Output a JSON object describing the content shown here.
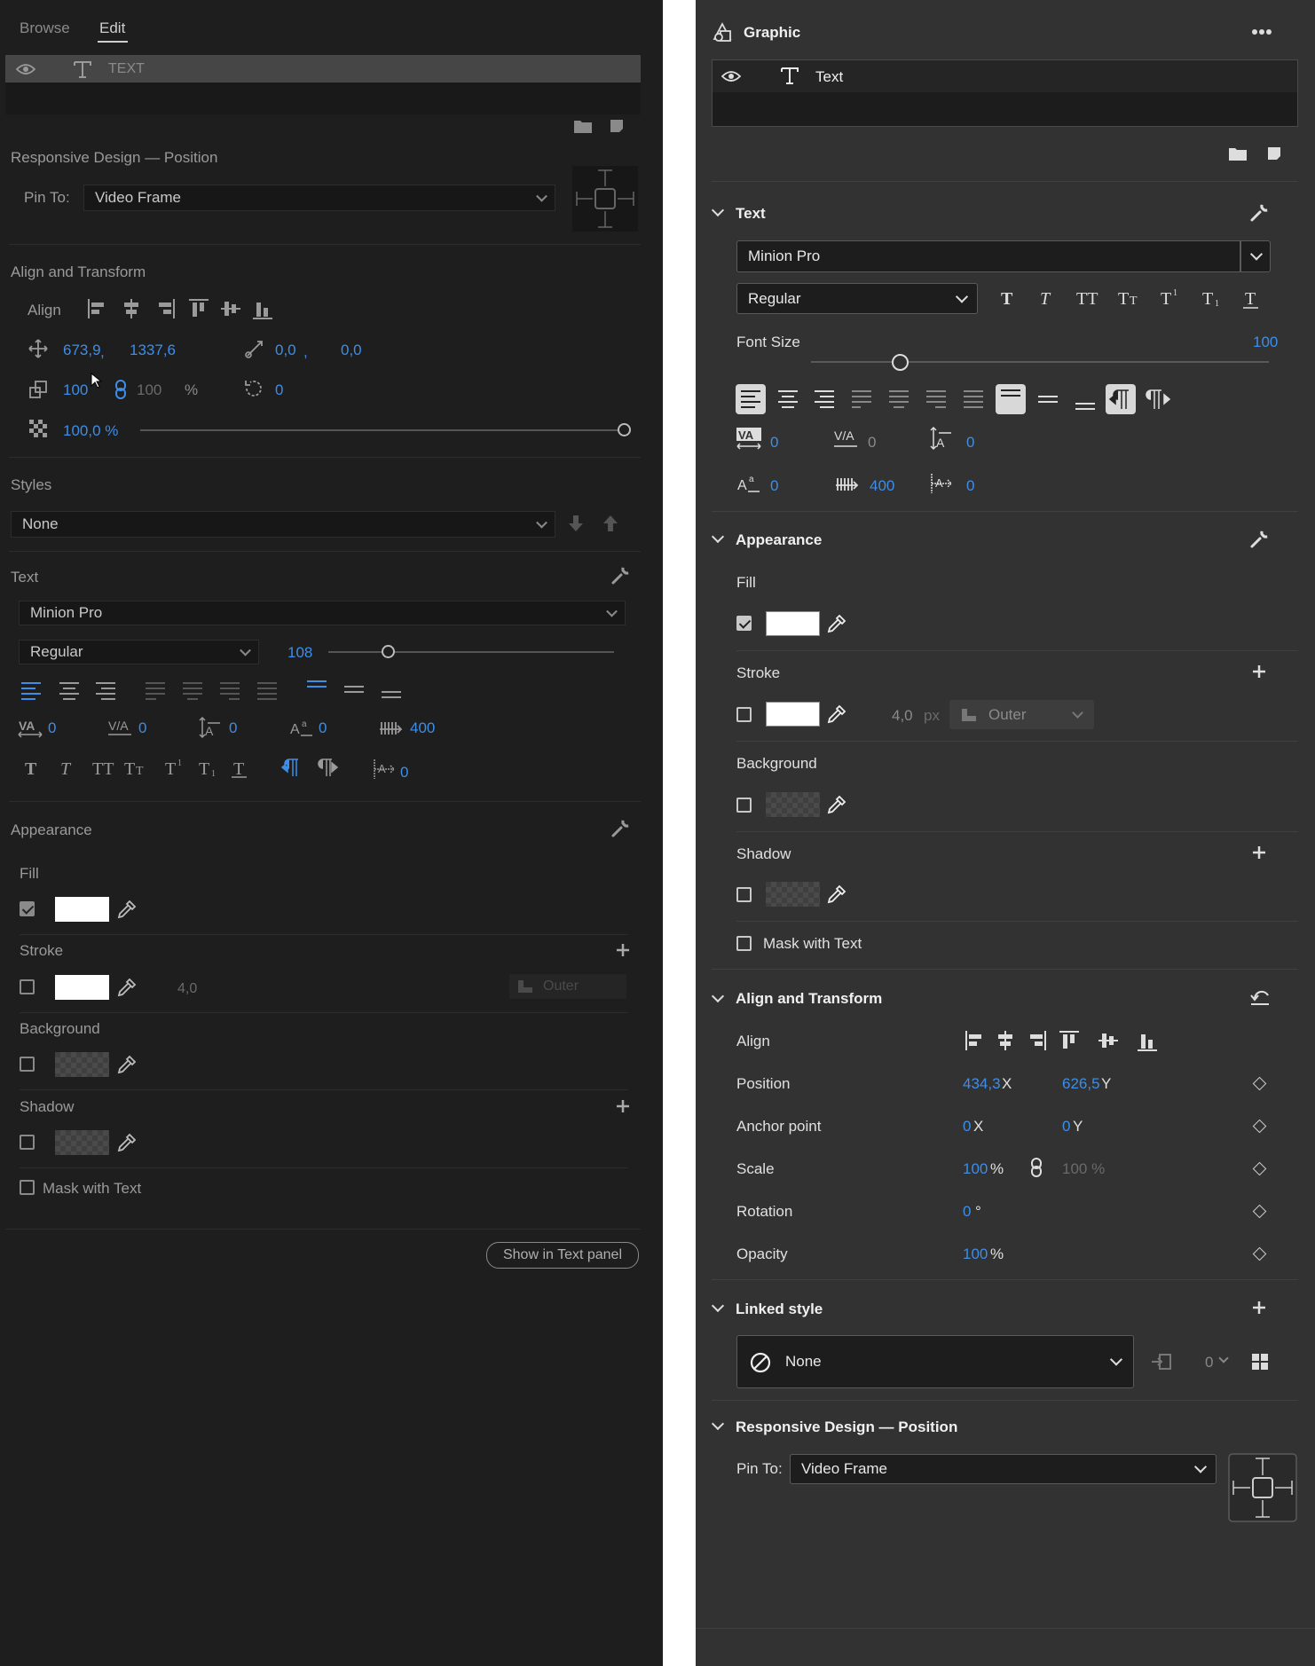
{
  "left": {
    "tabs": {
      "browse": "Browse",
      "edit": "Edit"
    },
    "layer": {
      "name": "TEXT"
    },
    "responsive": {
      "title": "Responsive Design — Position",
      "pin_label": "Pin To:",
      "pin_value": "Video Frame"
    },
    "align": {
      "title": "Align and Transform",
      "align_label": "Align",
      "pos_x": "673,9",
      "pos_y": "1337,6",
      "anchor_x": "0,0",
      "anchor_y": "0,0",
      "scale": "100",
      "scale_h": "100",
      "percent": "%",
      "rotation": "0",
      "opacity": "100,0 %",
      "opacity_value": 100
    },
    "styles": {
      "title": "Styles",
      "value": "None"
    },
    "text": {
      "title": "Text",
      "font": "Minion Pro",
      "style": "Regular",
      "size": "108",
      "size_value": 108,
      "kerning": "0",
      "tracking": "0",
      "leading": "0",
      "baseline": "0",
      "tsume": "400",
      "indent": "0"
    },
    "appearance": {
      "title": "Appearance",
      "fill": "Fill",
      "stroke": "Stroke",
      "stroke_width": "4,0",
      "stroke_type": "Outer",
      "background": "Background",
      "shadow": "Shadow",
      "mask": "Mask with Text"
    },
    "show_button": "Show in Text panel"
  },
  "right": {
    "panel_title": "Graphic",
    "layer": {
      "name": "Text"
    },
    "text": {
      "title": "Text",
      "font": "Minion Pro",
      "style": "Regular",
      "font_size_label": "Font Size",
      "font_size": "100",
      "font_size_value": 100,
      "kerning": "0",
      "tracking": "0",
      "leading": "0",
      "baseline": "0",
      "tsume": "400",
      "indent": "0"
    },
    "appearance": {
      "title": "Appearance",
      "fill": "Fill",
      "stroke": "Stroke",
      "stroke_width": "4,0",
      "stroke_unit": "px",
      "stroke_type": "Outer",
      "background": "Background",
      "shadow": "Shadow",
      "mask": "Mask with Text"
    },
    "align": {
      "title": "Align and Transform",
      "align_label": "Align",
      "position_label": "Position",
      "pos_x": "434,3",
      "pos_y": "626,5",
      "x": "X",
      "y": "Y",
      "anchor_label": "Anchor point",
      "anchor_x": "0",
      "anchor_y": "0",
      "scale_label": "Scale",
      "scale": "100",
      "scale_h": "100 %",
      "percent": "%",
      "rotation_label": "Rotation",
      "rotation": "0",
      "degree": "°",
      "opacity_label": "Opacity",
      "opacity": "100"
    },
    "linked": {
      "title": "Linked style",
      "value": "None",
      "count": "0"
    },
    "responsive": {
      "title": "Responsive Design — Position",
      "pin_label": "Pin To:",
      "pin_value": "Video Frame"
    }
  },
  "colors": {
    "accent": "#3d8ee8",
    "left_bg": "#1e1e1e",
    "right_bg": "#323232"
  }
}
